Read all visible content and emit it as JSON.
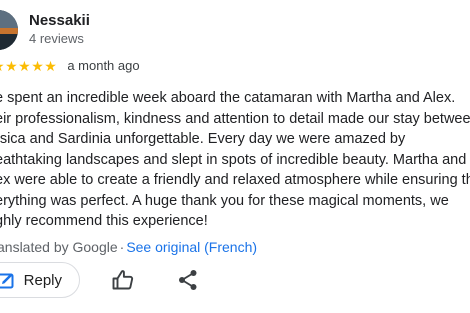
{
  "author": {
    "name": "Nessakii",
    "meta": "4 reviews"
  },
  "rating": {
    "stars": 5,
    "max_stars": 5,
    "star_glyph": "★",
    "star_color": "#fbbc04",
    "date": "a month ago"
  },
  "review": {
    "lines": [
      "e spent an incredible week aboard the catamaran with Martha and Alex.",
      "eir professionalism, kindness and attention to detail made our stay betwee",
      "rsica and Sardinia unforgettable. Every day we were amazed by",
      "eathtaking landscapes and slept in spots of incredible beauty. Martha and",
      "ex were able to create a friendly and relaxed atmosphere while ensuring th",
      "erything was perfect. A huge thank you for these magical moments, we",
      "ghly recommend this experience!"
    ]
  },
  "translation": {
    "label": "anslated by Google",
    "separator": "·",
    "link": "See original (French)",
    "link_color": "#1a73e8"
  },
  "actions": {
    "reply_label": "Reply",
    "reply_icon": "reply-edit-icon",
    "like_icon": "thumbs-up-icon",
    "share_icon": "share-icon"
  }
}
